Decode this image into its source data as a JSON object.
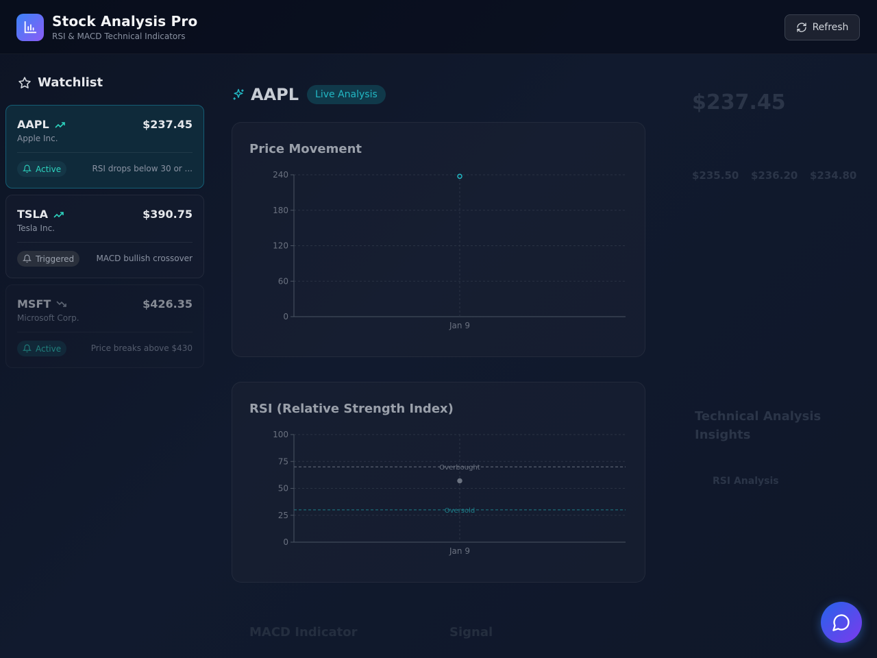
{
  "header": {
    "title": "Stock Analysis Pro",
    "subtitle": "RSI & MACD Technical Indicators",
    "refresh_label": "Refresh"
  },
  "sidebar": {
    "title": "Watchlist",
    "items": [
      {
        "symbol": "AAPL",
        "name": "Apple Inc.",
        "price": "$237.45",
        "trend": "up",
        "status": "Active",
        "condition": "RSI drops below 30 or ..."
      },
      {
        "symbol": "TSLA",
        "name": "Tesla Inc.",
        "price": "$390.75",
        "trend": "up",
        "status": "Triggered",
        "condition": "MACD bullish crossover"
      },
      {
        "symbol": "MSFT",
        "name": "Microsoft Corp.",
        "price": "$426.35",
        "trend": "down",
        "status": "Active",
        "condition": "Price breaks above $430"
      }
    ]
  },
  "main": {
    "symbol": "AAPL",
    "live_label": "Live Analysis",
    "price_panel": {
      "title": "Price Movement"
    },
    "rsi_panel": {
      "title": "RSI (Relative Strength Index)",
      "overbought_label": "Overbought",
      "oversold_label": "Oversold"
    },
    "bottom_labels": [
      "MACD Indicator",
      "Signal"
    ]
  },
  "right_panel": {
    "price": "$237.45",
    "levels": [
      "$235.50",
      "$236.20",
      "$234.80"
    ],
    "insights_title": "Technical Analysis Insights",
    "insight_item": "RSI Analysis"
  },
  "colors": {
    "accent": "#22b8c4",
    "brand_start": "#3b82f6",
    "brand_end": "#8b5cf6"
  },
  "icons": {
    "logo": "bar-chart-icon",
    "refresh": "refresh-icon",
    "watchlist": "star-icon",
    "chat": "chat-icon"
  },
  "chart_data": [
    {
      "type": "line",
      "title": "Price Movement",
      "x": [
        "Jan 9"
      ],
      "series": [
        {
          "values": [
            237.45
          ]
        }
      ],
      "ylim": [
        0,
        240
      ],
      "yticks": [
        0,
        60,
        120,
        180,
        240
      ],
      "grid": true
    },
    {
      "type": "line",
      "title": "RSI (Relative Strength Index)",
      "x": [
        "Jan 9"
      ],
      "series": [
        {
          "values": [
            57
          ]
        }
      ],
      "ylim": [
        0,
        100
      ],
      "yticks": [
        0,
        25,
        50,
        75,
        100
      ],
      "reference_lines": [
        {
          "value": 70,
          "label": "Overbought"
        },
        {
          "value": 30,
          "label": "Oversold"
        }
      ],
      "grid": true
    }
  ]
}
